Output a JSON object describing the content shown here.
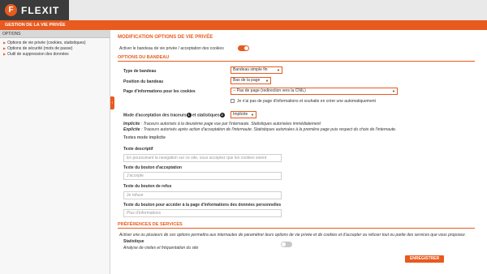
{
  "app": {
    "logo_letter": "F",
    "logo_name": "FLEXIT"
  },
  "title_bar": "GESTION DE LA VIE PRIVÉE",
  "sidebar": {
    "header": "OPTIONS",
    "items": [
      {
        "label": "Options de vie privée (cookies, statistiques)"
      },
      {
        "label": "Options de sécurité (mots de passe)"
      },
      {
        "label": "Outil de suppression des données"
      }
    ],
    "collapse_glyph": "‹"
  },
  "main": {
    "section_title": "MODIFICATION OPTIONS DE VIE PRIVÉE",
    "activate_label": "Activer le bandeau de vie privée / acceptation des cookies",
    "activate_on": true,
    "banner_options_title": "OPTIONS DU BANDEAU",
    "banner_type_label": "Type de bandeau",
    "banner_type_value": "Bandeau simple fin",
    "banner_position_label": "Position du bandeau",
    "banner_position_value": "Bas de la page",
    "info_page_label": "Page d'informations pour les cookies",
    "info_page_value": "-- Pas de page (redirection vers la CNIL)",
    "no_info_page_label": "Je n'ai pas de page d'informations et souhaite en créer une automatiquement",
    "accept_mode_label_1": "Mode d'acceptation des traceurs",
    "accept_mode_badge_1": "1",
    "accept_mode_label_2": " et statistiques",
    "accept_mode_badge_2": "2",
    "accept_mode_value": "Implicite",
    "implicit_term": "Implicite",
    "implicit_desc": " : Traceurs autorisés à la deuxième page vue par l'internaute. Statistiques autorisées immédiatement",
    "explicit_term": "Explicite",
    "explicit_desc": " : Traceurs autorisés après action d'acceptation de l'internaute. Statistiques autorisées à la première page puis respect du choix de l'internaute.",
    "implicit_texts_title": "Textes mode implicite",
    "desc_text_label": "Texte descriptif",
    "desc_text_value": "En poursuivant la navigation sur ce site, vous acceptez que les cookies soient",
    "accept_btn_label": "Texte du bouton d'acceptation",
    "accept_btn_placeholder": "J'accepte",
    "refuse_btn_label": "Texte du bouton de refus",
    "refuse_btn_placeholder": "Je refuse",
    "personal_data_btn_label": "Texte du bouton pour accéder à la page d'informations des données personnelles",
    "personal_data_btn_placeholder": "Plus d'informations",
    "services_title": "PRÉFÉRENCES DE SERVICES",
    "services_desc": "Activer une ou plusieurs de ces options permettra aux internautes de paramétrer leurs options de vie privée et de cookies et d'accepter ou refuser tout ou partie des services que vous proposez.",
    "stats_label": "Statistique",
    "stats_desc": "Analyse de visites et fréquentation du site",
    "stats_on": false,
    "save_label": "ENREGISTRER"
  },
  "colors": {
    "accent": "#e85a1e",
    "topbar": "#3b3b3b"
  },
  "icons": {
    "caret": "chevron-down-icon",
    "bullet": "triangle-right-icon"
  }
}
